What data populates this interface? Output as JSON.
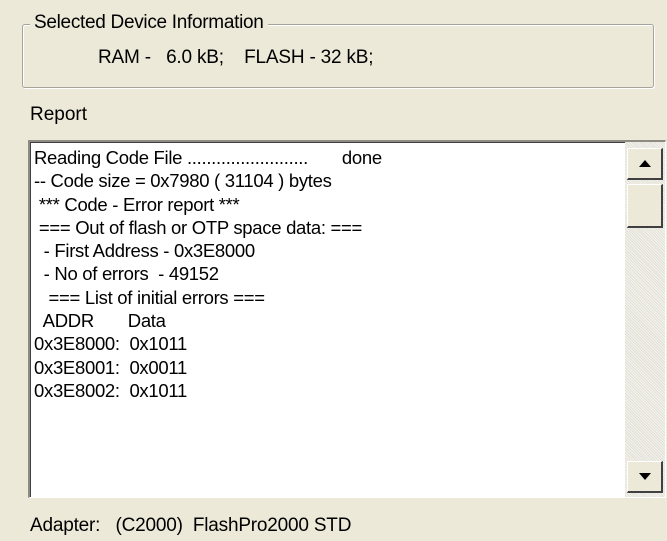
{
  "device_info": {
    "title": "Selected Device Information",
    "text": "RAM -   6.0 kB;    FLASH - 32 kB;"
  },
  "report": {
    "label": "Report",
    "lines": [
      "Reading Code File .........................       done",
      "-- Code size = 0x7980 ( 31104 ) bytes",
      " *** Code - Error report ***",
      " === Out of flash or OTP space data: ===",
      "  - First Address - 0x3E8000",
      "  - No of errors  - 49152",
      "   === List of initial errors ===",
      "  ADDR       Data",
      "0x3E8000:  0x1011",
      "0x3E8001:  0x0011",
      "0x3E8002:  0x1011"
    ]
  },
  "adapter": {
    "text": "Adapter:   (C2000)  FlashPro2000 STD"
  }
}
